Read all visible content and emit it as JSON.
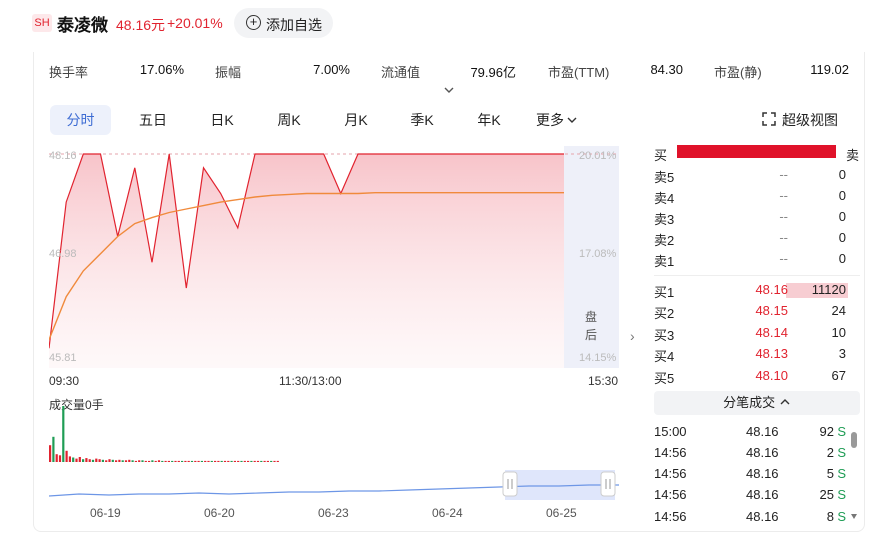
{
  "header": {
    "badge": "SH",
    "stock_name": "泰凌微",
    "price": "48.16元",
    "change_pct": "+20.01%",
    "add_button": "添加自选"
  },
  "stats": [
    {
      "label": "换手率",
      "value": "17.06%"
    },
    {
      "label": "振幅",
      "value": "7.00%"
    },
    {
      "label": "流通值",
      "value": "79.96亿"
    },
    {
      "label": "市盈(TTM)",
      "value": "84.30"
    },
    {
      "label": "市盈(静)",
      "value": "119.02"
    }
  ],
  "tabs": [
    "分时",
    "五日",
    "日K",
    "周K",
    "月K",
    "季K",
    "年K",
    "更多"
  ],
  "active_tab": "分时",
  "super_view": "超级视图",
  "chart_data": {
    "type": "line",
    "y_left_ticks": [
      "48.16",
      "45.81"
    ],
    "y_left_mid": "46.98",
    "y_right_ticks": [
      "20.01%",
      "17.08%",
      "14.15%"
    ],
    "x_ticks": [
      "09:30",
      "11:30/13:00",
      "15:30"
    ],
    "after_hours_label": "盘后",
    "series": [
      {
        "values": [
          45.9,
          47.6,
          48.16,
          48.16,
          47.2,
          48.0,
          46.9,
          48.16,
          46.6,
          48.0,
          47.7,
          47.3,
          48.16,
          48.16,
          48.16,
          48.16,
          48.16,
          47.7,
          48.16,
          48.16,
          48.16,
          48.16,
          48.16,
          48.16,
          48.16,
          48.16,
          48.16,
          48.16,
          48.16,
          48.16,
          48.16
        ]
      },
      {
        "values": [
          46.0,
          46.5,
          46.8,
          47.0,
          47.2,
          47.35,
          47.42,
          47.48,
          47.52,
          47.56,
          47.6,
          47.63,
          47.66,
          47.68,
          47.69,
          47.7,
          47.7,
          47.7,
          47.7,
          47.71,
          47.71,
          47.71,
          47.71,
          47.71,
          47.71,
          47.71,
          47.71,
          47.71,
          47.71,
          47.71,
          47.71
        ]
      }
    ],
    "ylim": [
      45.81,
      48.16
    ]
  },
  "volume": {
    "label": "成交量0手",
    "bars": [
      30,
      45,
      14,
      12,
      100,
      20,
      10,
      8,
      6,
      9,
      5,
      7,
      5,
      4,
      6,
      5,
      4,
      3,
      5,
      4,
      3,
      4,
      3,
      3,
      4,
      3,
      2,
      3,
      3,
      2,
      2,
      3,
      2,
      3,
      2,
      2,
      2,
      2,
      2,
      2,
      2,
      2,
      2,
      2,
      2,
      2,
      2,
      2,
      2,
      2,
      2,
      2,
      2,
      2,
      2,
      2,
      2,
      2,
      2,
      2,
      2,
      2,
      2,
      2,
      2,
      2,
      2,
      2,
      2,
      2
    ]
  },
  "navigator": {
    "dates": [
      "06-19",
      "06-20",
      "06-23",
      "06-24",
      "06-25"
    ]
  },
  "orderbook": {
    "buy_label": "买",
    "sell_label": "卖",
    "asks": [
      {
        "label": "卖5",
        "price": "--",
        "qty": "0"
      },
      {
        "label": "卖4",
        "price": "--",
        "qty": "0"
      },
      {
        "label": "卖3",
        "price": "--",
        "qty": "0"
      },
      {
        "label": "卖2",
        "price": "--",
        "qty": "0"
      },
      {
        "label": "卖1",
        "price": "--",
        "qty": "0"
      }
    ],
    "bids": [
      {
        "label": "买1",
        "price": "48.16",
        "qty": "11120"
      },
      {
        "label": "买2",
        "price": "48.15",
        "qty": "24"
      },
      {
        "label": "买3",
        "price": "48.14",
        "qty": "10"
      },
      {
        "label": "买4",
        "price": "48.13",
        "qty": "3"
      },
      {
        "label": "买5",
        "price": "48.10",
        "qty": "67"
      }
    ],
    "tick_button": "分笔成交",
    "ticks": [
      {
        "time": "15:00",
        "price": "48.16",
        "vol": "92",
        "side": "S"
      },
      {
        "time": "14:56",
        "price": "48.16",
        "vol": "2",
        "side": "S"
      },
      {
        "time": "14:56",
        "price": "48.16",
        "vol": "5",
        "side": "S"
      },
      {
        "time": "14:56",
        "price": "48.16",
        "vol": "25",
        "side": "S"
      },
      {
        "time": "14:56",
        "price": "48.16",
        "vol": "8",
        "side": "S"
      }
    ]
  },
  "colors": {
    "up": "#e1232f",
    "down": "#1f9d55",
    "avg": "#f08a3c",
    "accent": "#3c6bd3"
  }
}
